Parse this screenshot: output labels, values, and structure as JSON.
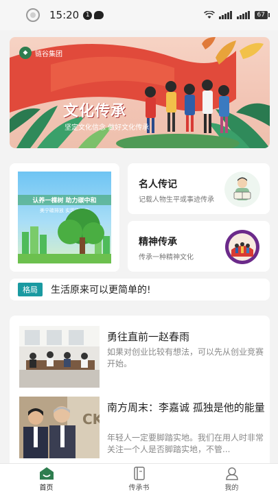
{
  "status": {
    "time": "15:20",
    "notification_count": "1",
    "battery": "67"
  },
  "banner": {
    "logo_text": "链谷集团",
    "title": "文化传承",
    "subtitle": "坚定文化信念  做好文化传承"
  },
  "promo_poster": {
    "line1": "认养一棵树  助力碳中和",
    "line2": "美宁碳排放  实现碳中和"
  },
  "quick_cards": [
    {
      "title": "名人传记",
      "subtitle": "记载人物生平或事迹传承"
    },
    {
      "title": "精神传承",
      "subtitle": "传承一种精神文化"
    }
  ],
  "tagline": {
    "tag": "格局",
    "text": "生活原来可以更简单的!"
  },
  "news": [
    {
      "title": "勇往直前一赵春雨",
      "desc": "如果对创业比较有想法，可以先从创业竞赛开始。"
    },
    {
      "title": "南方周末：李嘉诚 孤独是他的能量",
      "desc": "年轻人一定要脚踏实地。我们在用人时非常关注一个人是否脚踏实地，不管..."
    }
  ],
  "bottom_nav": [
    {
      "label": "首页",
      "icon": "home-icon",
      "active": true
    },
    {
      "label": "传承书",
      "icon": "book-icon",
      "active": false
    },
    {
      "label": "我的",
      "icon": "profile-icon",
      "active": false
    }
  ],
  "colors": {
    "accent_green": "#2e7d4f",
    "tag_teal": "#1a9aa1",
    "banner_red": "#e14a3b"
  }
}
